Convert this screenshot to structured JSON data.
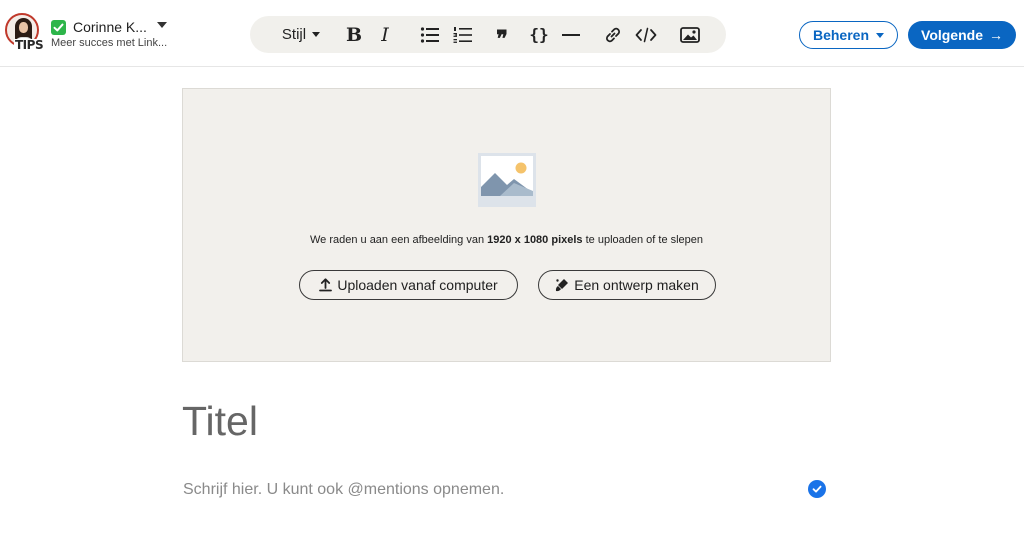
{
  "header": {
    "author_name": "Corinne K...",
    "author_subtitle": "Meer succes met Link...",
    "avatar_badge_text": "TIPS",
    "verified_color": "#2db54a"
  },
  "toolbar": {
    "style_label": "Stijl",
    "bold_label": "B",
    "italic_label": "I",
    "quote_label": "❞",
    "code_label": "{}",
    "icons": [
      "bullet-list-icon",
      "numbered-list-icon",
      "quote-icon",
      "code-block-icon",
      "horizontal-rule-icon",
      "link-icon",
      "embed-code-icon",
      "image-icon"
    ]
  },
  "actions": {
    "manage_label": "Beheren",
    "next_label": "Volgende",
    "accent_color": "#0a66c2"
  },
  "cover": {
    "hint_prefix": "We raden u aan een afbeelding van ",
    "hint_bold": "1920 x 1080 pixels",
    "hint_suffix": " te uploaden of te slepen",
    "upload_label": "Uploaden vanaf computer",
    "design_label": "Een ontwerp maken"
  },
  "editor": {
    "title_placeholder": "Titel",
    "body_placeholder": "Schrijf hier. U kunt ook @mentions opnemen."
  }
}
